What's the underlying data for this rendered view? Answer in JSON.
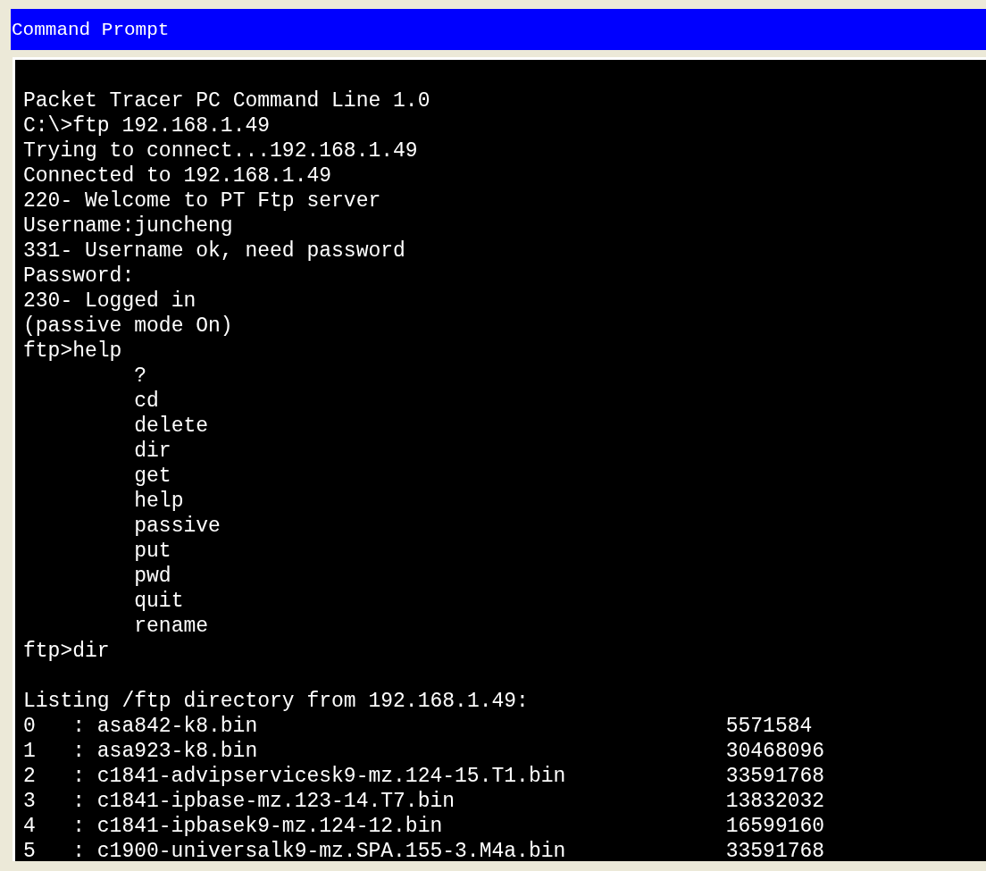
{
  "window": {
    "title": "Command Prompt"
  },
  "terminal": {
    "lines": [
      {
        "kind": "blank"
      },
      {
        "kind": "output",
        "text": "Packet Tracer PC Command Line 1.0"
      },
      {
        "kind": "output",
        "text": "C:\\>ftp 192.168.1.49"
      },
      {
        "kind": "output",
        "text": "Trying to connect...192.168.1.49"
      },
      {
        "kind": "output",
        "text": "Connected to 192.168.1.49"
      },
      {
        "kind": "output",
        "text": "220- Welcome to PT Ftp server"
      },
      {
        "kind": "output",
        "text": "Username:juncheng"
      },
      {
        "kind": "output",
        "text": "331- Username ok, need password"
      },
      {
        "kind": "output",
        "text": "Password:"
      },
      {
        "kind": "output",
        "text": "230- Logged in"
      },
      {
        "kind": "output",
        "text": "(passive mode On)"
      },
      {
        "kind": "output",
        "text": "ftp>help"
      },
      {
        "kind": "help_entry",
        "text": "?"
      },
      {
        "kind": "help_entry",
        "text": "cd"
      },
      {
        "kind": "help_entry",
        "text": "delete"
      },
      {
        "kind": "help_entry",
        "text": "dir"
      },
      {
        "kind": "help_entry",
        "text": "get"
      },
      {
        "kind": "help_entry",
        "text": "help"
      },
      {
        "kind": "help_entry",
        "text": "passive"
      },
      {
        "kind": "help_entry",
        "text": "put"
      },
      {
        "kind": "help_entry",
        "text": "pwd"
      },
      {
        "kind": "help_entry",
        "text": "quit"
      },
      {
        "kind": "help_entry",
        "text": "rename"
      },
      {
        "kind": "output",
        "text": "ftp>dir"
      },
      {
        "kind": "blank"
      },
      {
        "kind": "output",
        "text": "Listing /ftp directory from 192.168.1.49:"
      },
      {
        "kind": "listing_entry",
        "index": "0",
        "separator": ":",
        "name": "asa842-k8.bin",
        "size": "5571584"
      },
      {
        "kind": "listing_entry",
        "index": "1",
        "separator": ":",
        "name": "asa923-k8.bin",
        "size": "30468096"
      },
      {
        "kind": "listing_entry",
        "index": "2",
        "separator": ":",
        "name": "c1841-advipservicesk9-mz.124-15.T1.bin",
        "size": "33591768"
      },
      {
        "kind": "listing_entry",
        "index": "3",
        "separator": ":",
        "name": "c1841-ipbase-mz.123-14.T7.bin",
        "size": "13832032"
      },
      {
        "kind": "listing_entry",
        "index": "4",
        "separator": ":",
        "name": "c1841-ipbasek9-mz.124-12.bin",
        "size": "16599160"
      },
      {
        "kind": "listing_entry",
        "index": "5",
        "separator": ":",
        "name": "c1900-universalk9-mz.SPA.155-3.M4a.bin",
        "size": "33591768"
      }
    ]
  }
}
